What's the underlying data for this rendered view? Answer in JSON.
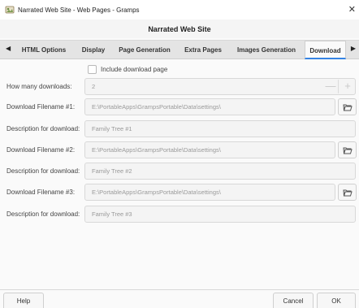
{
  "window": {
    "title": "Narrated Web Site - Web Pages - Gramps",
    "close_glyph": "✕"
  },
  "header": {
    "title": "Narrated Web Site"
  },
  "tabs": {
    "left_arrow": "◀",
    "right_arrow": "▶",
    "items": [
      {
        "label": "HTML Options"
      },
      {
        "label": "Display"
      },
      {
        "label": "Page Generation"
      },
      {
        "label": "Extra Pages"
      },
      {
        "label": "Images Generation"
      },
      {
        "label": "Download"
      }
    ],
    "active": "Download"
  },
  "download": {
    "include_label": "Include download page",
    "include_checked": false,
    "how_many_label": "How many downloads:",
    "how_many_value": "2",
    "minus_glyph": "—",
    "plus_glyph": "+",
    "entries": [
      {
        "filename_label": "Download Filename #1:",
        "filename_value": "E:\\PortableApps\\GrampsPortable\\Data\\settings\\",
        "description_label": "Description for download:",
        "description_value": "Family Tree #1"
      },
      {
        "filename_label": "Download Filename #2:",
        "filename_value": "E:\\PortableApps\\GrampsPortable\\Data\\settings\\",
        "description_label": "Description for download:",
        "description_value": "Family Tree #2"
      },
      {
        "filename_label": "Download Filename #3:",
        "filename_value": "E:\\PortableApps\\GrampsPortable\\Data\\settings\\",
        "description_label": "Description for download:",
        "description_value": "Family Tree #3"
      }
    ]
  },
  "footer": {
    "help_label": "Help",
    "cancel_label": "Cancel",
    "ok_label": "OK"
  },
  "colors": {
    "accent": "#3584e4"
  },
  "icons": {
    "app": "gramps-app-icon",
    "folder": "folder-open-icon"
  }
}
